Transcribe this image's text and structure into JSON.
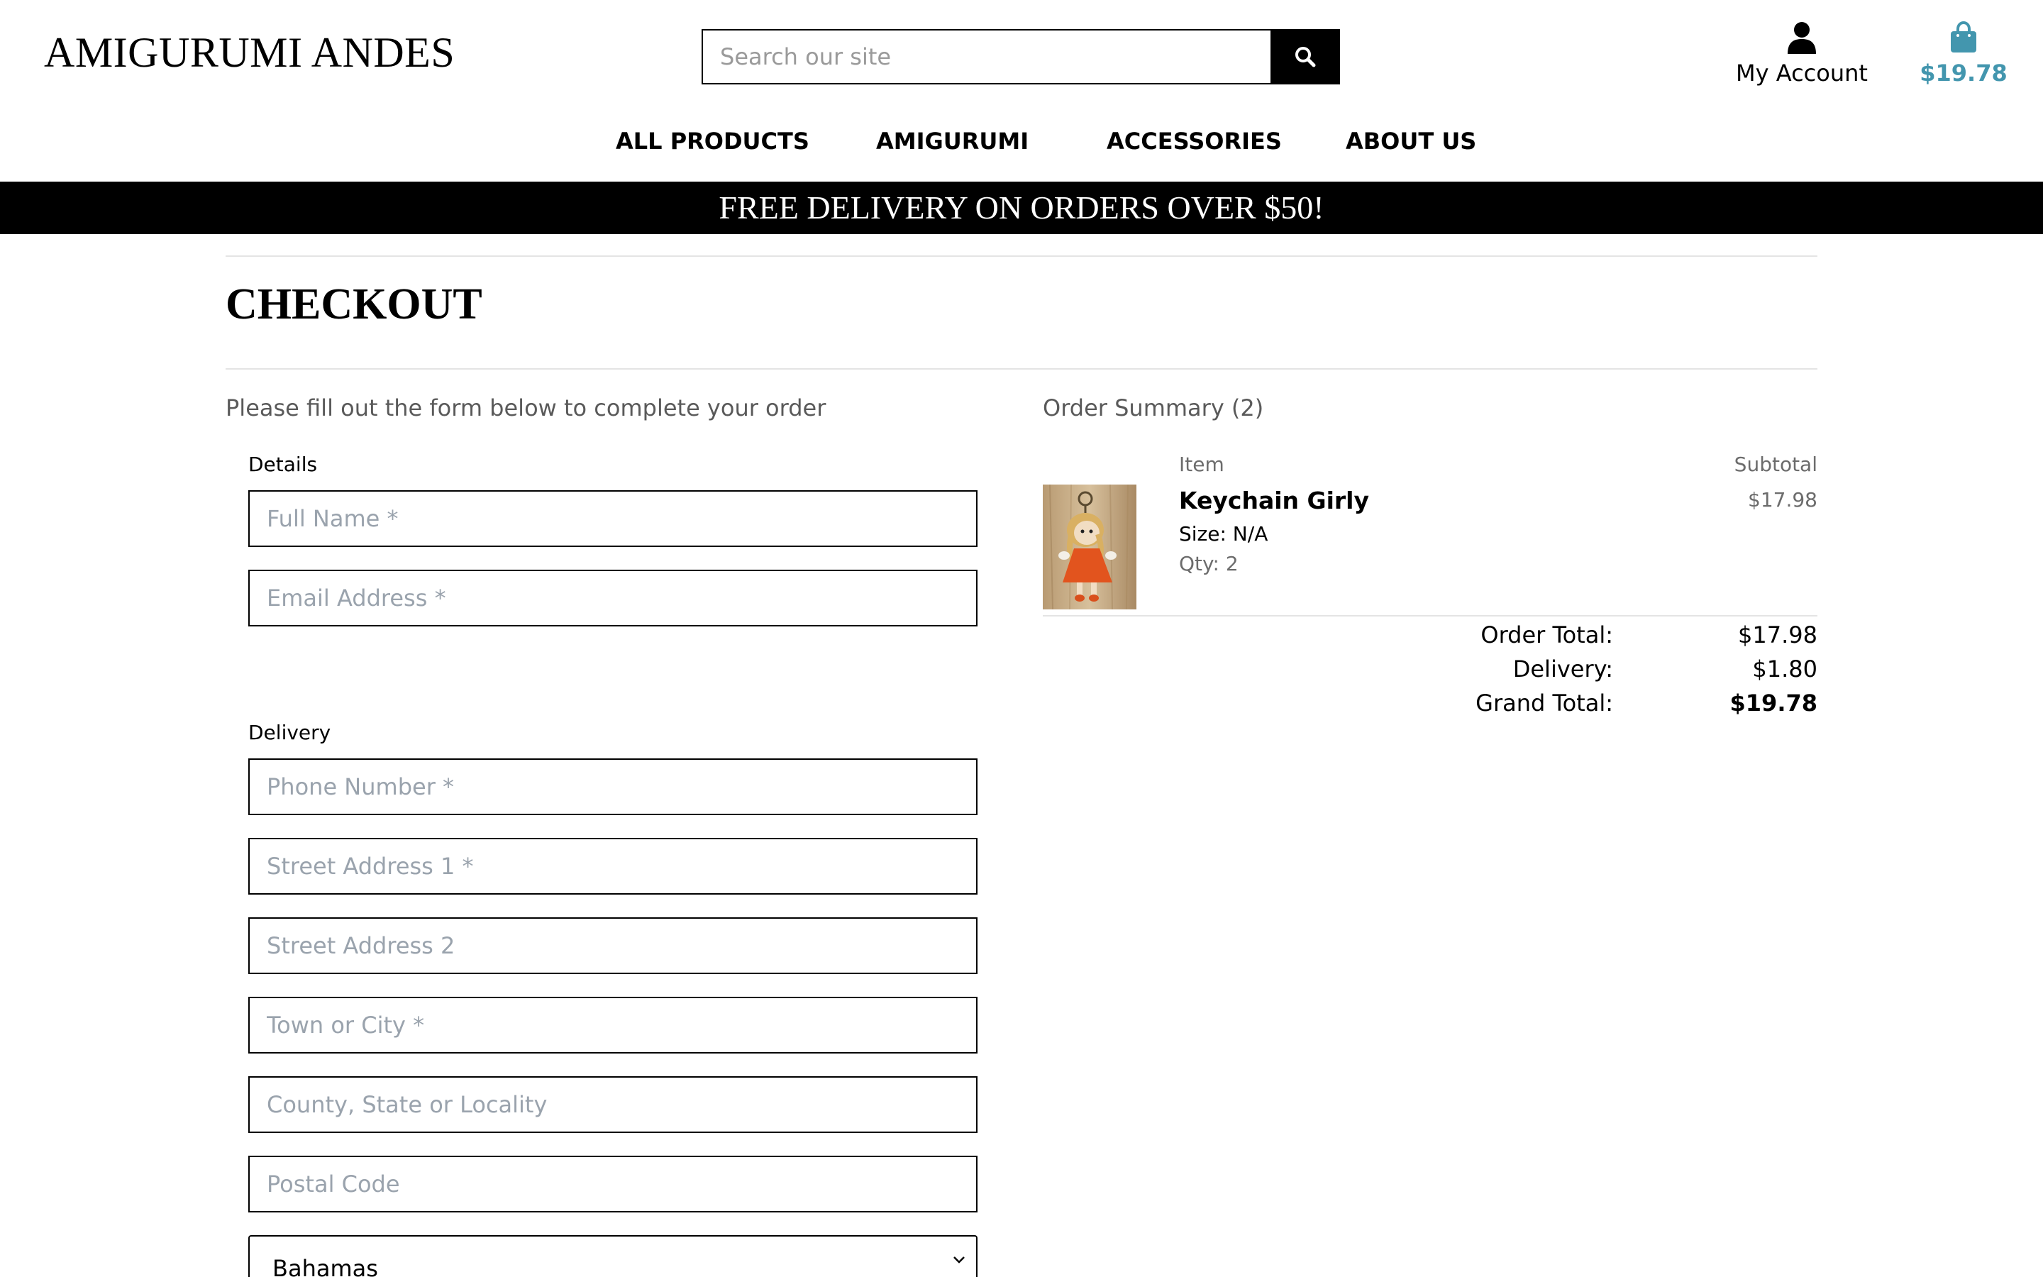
{
  "header": {
    "logo": "AMIGURUMI ANDES",
    "search_placeholder": "Search our site",
    "account_label": "My Account",
    "cart_total": "$19.78",
    "cart_color": "#4396ae"
  },
  "nav": {
    "items": [
      {
        "label": "ALL PRODUCTS"
      },
      {
        "label": "AMIGURUMI"
      },
      {
        "label": "ACCESSORIES"
      },
      {
        "label": "ABOUT US"
      }
    ]
  },
  "banner": {
    "text": "FREE DELIVERY ON ORDERS OVER $50!"
  },
  "checkout": {
    "title": "CHECKOUT",
    "intro": "Please fill out the form below to complete your order",
    "details_legend": "Details",
    "delivery_legend": "Delivery",
    "fields": {
      "full_name": "Full Name *",
      "email": "Email Address *",
      "phone": "Phone Number *",
      "street1": "Street Address 1 *",
      "street2": "Street Address 2",
      "town": "Town or City *",
      "county": "County, State or Locality",
      "postcode": "Postal Code"
    },
    "country_selected": "Bahamas"
  },
  "summary": {
    "title": "Order Summary (2)",
    "col_item": "Item",
    "col_subtotal": "Subtotal",
    "items": [
      {
        "name": "Keychain Girly",
        "size": "Size: N/A",
        "qty": "Qty: 2",
        "subtotal": "$17.98",
        "image_icon": "keychain-doll-image"
      }
    ],
    "order_total_label": "Order Total:",
    "order_total": "$17.98",
    "delivery_label": "Delivery:",
    "delivery": "$1.80",
    "grand_total_label": "Grand Total:",
    "grand_total": "$19.78"
  }
}
